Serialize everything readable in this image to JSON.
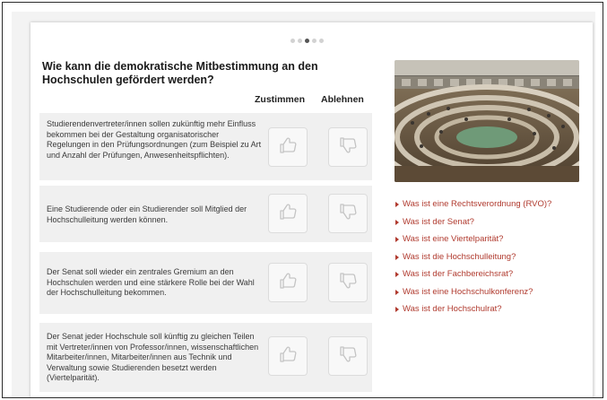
{
  "carousel": {
    "count": 5,
    "active_index": 2
  },
  "question": "Wie kann die demokratische Mitbestimmung an den Hochschulen gefördert werden?",
  "columns": {
    "agree": "Zustimmen",
    "reject": "Ablehnen"
  },
  "statements": [
    {
      "text": "Studierendenvertreter/innen sollen zukünftig mehr Einfluss bekommen bei der Gestaltung organisatorischer Regelungen in den Prüfungsordnungen (zum Beispiel zu Art und Anzahl der Prüfungen, Anwesenheitspflichten)."
    },
    {
      "text": "Eine Studierende oder ein Studierender soll Mitglied der Hochschulleitung werden können."
    },
    {
      "text": "Der Senat soll wieder ein zentrales Gremium an den Hochschulen werden und eine stärkere Rolle bei der Wahl der Hochschulleitung bekommen."
    },
    {
      "text": "Der Senat jeder Hochschule soll künftig zu gleichen Teilen mit Vertreter/innen von Professor/innen, wissenschaftlichen Mitarbeiter/innen, Mitarbeiter/innen aus Technik und Verwaltung sowie Studierenden besetzt werden (Viertelparität)."
    }
  ],
  "icons": {
    "agree": "thumbs-up-icon",
    "reject": "thumbs-down-icon",
    "link": "triangle-right-icon"
  },
  "links": [
    "Was ist eine Rechtsverordnung (RVO)?",
    "Was ist der Senat?",
    "Was ist eine Viertelparität?",
    "Was ist die Hochschulleitung?",
    "Was ist der Fachbereichsrat?",
    "Was ist eine Hochschulkonferenz?",
    "Was ist der Hochschulrat?"
  ],
  "colors": {
    "link": "#b03a2e",
    "statement_bg": "#f0f0f0",
    "page_bg": "#f3f3f3"
  }
}
